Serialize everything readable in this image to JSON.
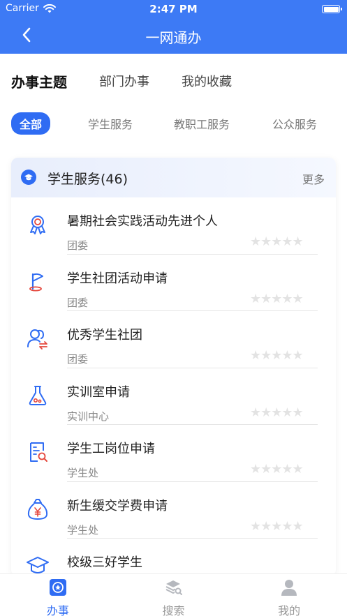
{
  "status_bar": {
    "carrier": "Carrier",
    "time": "2:47 PM"
  },
  "nav": {
    "title": "一网通办"
  },
  "top_tabs": [
    {
      "label": "办事主题",
      "active": true
    },
    {
      "label": "部门办事",
      "active": false
    },
    {
      "label": "我的收藏",
      "active": false
    }
  ],
  "filters": [
    {
      "label": "全部",
      "active": true
    },
    {
      "label": "学生服务",
      "active": false
    },
    {
      "label": "教职工服务",
      "active": false
    },
    {
      "label": "公众服务",
      "active": false
    }
  ],
  "section": {
    "title": "学生服务(46)",
    "more": "更多"
  },
  "items": [
    {
      "name": "暑期社会实践活动先进个人",
      "dept": "团委",
      "stars": "★★★★★",
      "rating": 0,
      "icon": "award-medal-icon"
    },
    {
      "name": "学生社团活动申请",
      "dept": "团委",
      "stars": "★★★★★",
      "rating": 0,
      "icon": "flag-icon"
    },
    {
      "name": "优秀学生社团",
      "dept": "团委",
      "stars": "★★★★★",
      "rating": 0,
      "icon": "users-exchange-icon"
    },
    {
      "name": "实训室申请",
      "dept": "实训中心",
      "stars": "★★★★★",
      "rating": 0,
      "icon": "flask-icon"
    },
    {
      "name": "学生工岗位申请",
      "dept": "学生处",
      "stars": "★★★★★",
      "rating": 0,
      "icon": "document-search-icon"
    },
    {
      "name": "新生缓交学费申请",
      "dept": "学生处",
      "stars": "★★★★★",
      "rating": 0,
      "icon": "money-bag-icon"
    },
    {
      "name": "校级三好学生",
      "dept": "",
      "stars": "",
      "rating": 0,
      "icon": "graduation-cap-icon"
    }
  ],
  "tabbar": [
    {
      "label": "办事",
      "active": true,
      "icon": "star-badge-icon"
    },
    {
      "label": "搜索",
      "active": false,
      "icon": "search-stack-icon"
    },
    {
      "label": "我的",
      "active": false,
      "icon": "person-icon"
    }
  ],
  "colors": {
    "primary": "#3d7af5",
    "accent": "#2f6cf3",
    "icon_red": "#e5473c"
  }
}
